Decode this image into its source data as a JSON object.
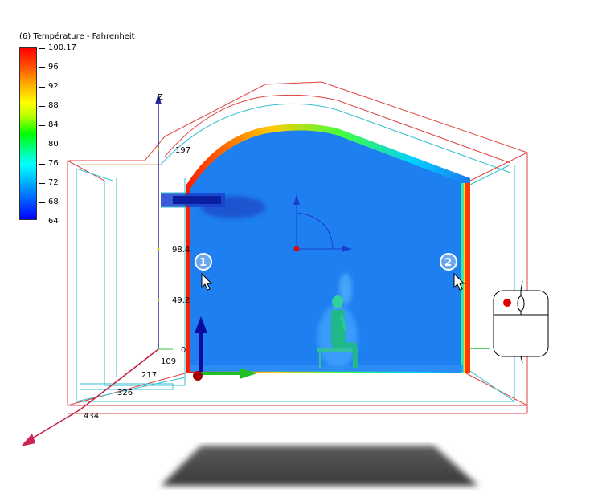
{
  "legend": {
    "title": "(6) Température - Fahrenheit",
    "ticks": [
      "100.17",
      "96",
      "92",
      "88",
      "84",
      "80",
      "76",
      "72",
      "68",
      "64"
    ]
  },
  "axis": {
    "z_label": "Z",
    "z_ticks": [
      "197",
      "98.4",
      "49.2",
      "0"
    ],
    "floor_ticks": [
      "109",
      "217",
      "326",
      "434"
    ]
  },
  "markers": [
    {
      "label": "1"
    },
    {
      "label": "2"
    }
  ],
  "colors": {
    "background": "#ffffff",
    "field_blue": "#1e78f0",
    "hot_edge": "#ff2a00",
    "wireframe_red": "#e04040",
    "wireframe_cyan": "#30c0d0",
    "axis_z": "#2a2aa0",
    "axis_x": "#c02040",
    "triad_up": "#0a0aa0",
    "triad_right": "#20c020",
    "triad_origin": "#a00000"
  },
  "view_widget": {
    "icon": "mouse-navigation-icon"
  }
}
